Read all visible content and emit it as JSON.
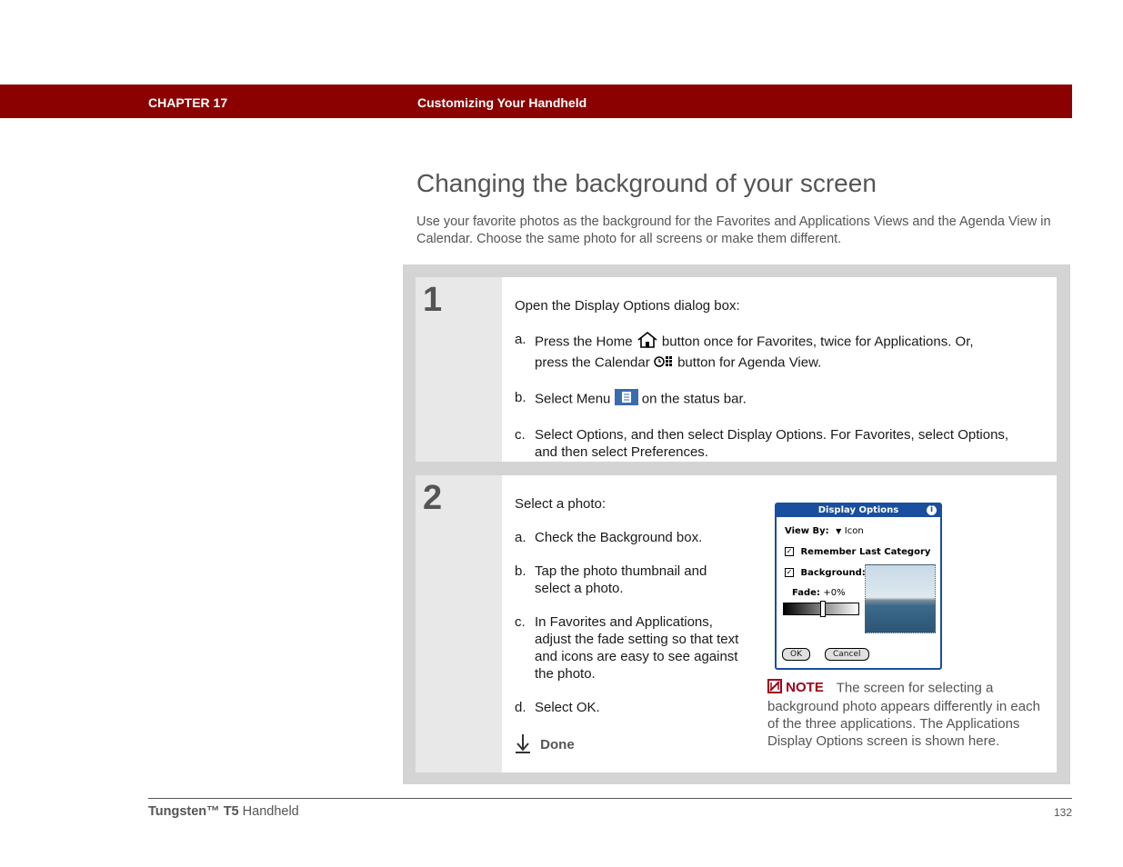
{
  "header": {
    "chapter": "CHAPTER 17",
    "section": "Customizing Your Handheld",
    "bar_color": "#8b0000"
  },
  "page": {
    "title": "Changing the background of your screen",
    "intro": "Use your favorite photos as the background for the Favorites and Applications Views and the Agenda View in Calendar. Choose the same photo for all screens or make them different."
  },
  "step1": {
    "number": "1",
    "lead": "Open the Display Options dialog box:",
    "a_label": "a.",
    "a_text1": "Press the Home",
    "a_text2": "button once for Favorites, twice for Applications. Or,",
    "a_text3": "press the Calendar",
    "a_text4": "button for Agenda View.",
    "b_label": "b.",
    "b_text1": "Select Menu",
    "b_text2": "on the status bar.",
    "c_label": "c.",
    "c_text": "Select Options, and then select Display Options. For Favorites, select Options, and then select Preferences.",
    "icons": [
      "home-icon",
      "calendar-icon",
      "menu-icon"
    ]
  },
  "step2": {
    "number": "2",
    "lead": "Select a photo:",
    "a_label": "a.",
    "a_text": "Check the Background box.",
    "b_label": "b.",
    "b_text": "Tap the photo thumbnail and select a photo.",
    "c_label": "c.",
    "c_text": "In Favorites and Applications, adjust the fade setting so that text and icons are easy to see against the photo.",
    "d_label": "d.",
    "d_text": "Select OK.",
    "done": "Done",
    "note_label": "NOTE",
    "note_text": "The screen for selecting a background photo appears differently in each of the three applications. The Applications Display Options screen is shown here."
  },
  "palm_screen": {
    "title": "Display Options",
    "view_by_label": "View By:",
    "view_by_value": "Icon",
    "remember_label": "Remember Last Category",
    "remember_checked": true,
    "background_label": "Background:",
    "background_checked": true,
    "fade_label": "Fade:",
    "fade_value": "+0%",
    "ok_label": "OK",
    "cancel_label": "Cancel",
    "accent": "#1a4fa0"
  },
  "footer": {
    "product_bold": "Tungsten™ T5",
    "product_rest": "Handheld",
    "page_number": "132"
  }
}
